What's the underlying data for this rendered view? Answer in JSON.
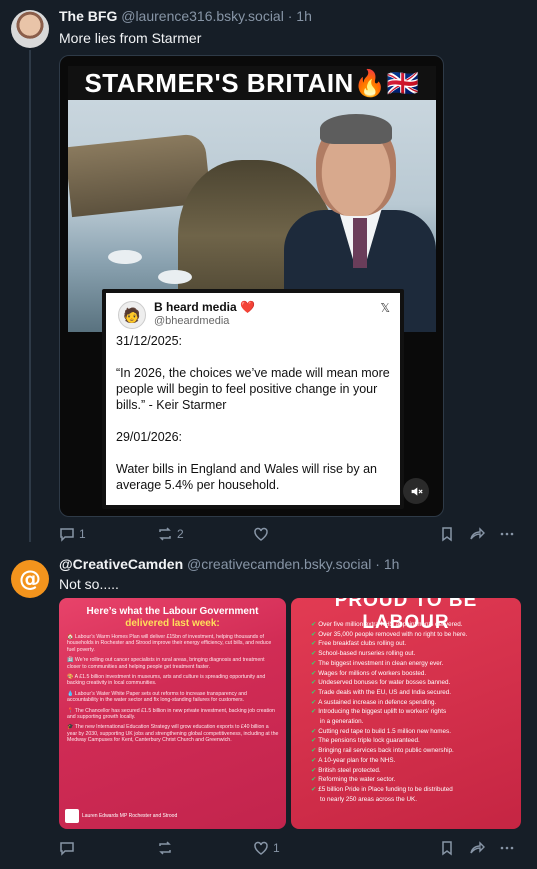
{
  "post1": {
    "author_name": "The BFG",
    "author_handle": "@laurence316.bsky.social",
    "time": "1h",
    "text": "More lies from Starmer",
    "image": {
      "banner": "STARMER'S BRITAIN🔥🇬🇧",
      "quote": {
        "name": "B heard media",
        "heart": "❤️",
        "handle": "@bheardmedia",
        "date1": "31/12/2025:",
        "quote1": "“In 2026, the choices we’ve made will mean more people will begin to feel positive change in your bills.” - Keir Starmer",
        "date2": "29/01/2026:",
        "quote2": "Water bills in England and Wales will rise by an average 5.4% per household."
      }
    },
    "actions": {
      "replies": "1",
      "reposts": "2",
      "likes": ""
    }
  },
  "post2": {
    "author_name": "@CreativeCamden",
    "author_handle": "@creativecamden.bsky.social",
    "time": "1h",
    "text": "Not so.....",
    "image_left": {
      "title_line1": "Here’s what the Labour Government",
      "title_line2": "delivered last week:",
      "items": [
        "🏠 Labour’s Warm Homes Plan will deliver £15bn of investment, helping thousands of households in Rochester and Strood improve their energy efficiency, cut bills, and reduce fuel poverty.",
        "🏥 We’re rolling out cancer specialists in rural areas, bringing diagnosis and treatment closer to communities and helping people get treatment faster.",
        "🎨 A £1.5 billion investment in museums, arts and culture is spreading opportunity and backing creativity in local communities.",
        "💧 Labour’s Water White Paper sets out reforms to increase transparency and accountability in the water sector and fix long-standing failures for customers.",
        "📍 The Chancellor has secured £1.5 billion in new private investment, backing job creation and supporting growth locally.",
        "🎓 The new International Education Strategy will grow education exports to £40 billion a year by 2030, supporting UK jobs and strengthening global competitiveness, including at the Medway Campuses for Kent, Canterbury Christ Church and Greenwich."
      ],
      "footer": "Lauren Edwards MP Rochester and Strood"
    },
    "image_right": {
      "title": "PROUD TO BE LABOUR",
      "items": [
        "Over five million extra NHS appointments delivered.",
        "Over 35,000 people removed with no right to be here.",
        "Free breakfast clubs rolling out.",
        "School-based nurseries rolling out.",
        "The biggest investment in clean energy ever.",
        "Wages for millions of workers boosted.",
        "Undeserved bonuses for water bosses banned.",
        "Trade deals with the EU, US and India secured.",
        "A sustained increase in defence spending.",
        "Introducing the biggest uplift to workers’ rights",
        "in a generation.",
        "Cutting red tape to build 1.5 million new homes.",
        "The pensions triple lock guaranteed.",
        "Bringing rail services back into public ownership.",
        "A 10-year plan for the NHS.",
        "British steel protected.",
        "Reforming the water sector.",
        "£5 billion Pride in Place funding to be distributed",
        "to nearly 250 areas across the UK."
      ]
    },
    "actions": {
      "replies": "",
      "reposts": "",
      "likes": "1"
    }
  },
  "colors": {
    "background": "#161e27",
    "muted": "#8795a6",
    "avatar_camden": "#f3941d"
  }
}
